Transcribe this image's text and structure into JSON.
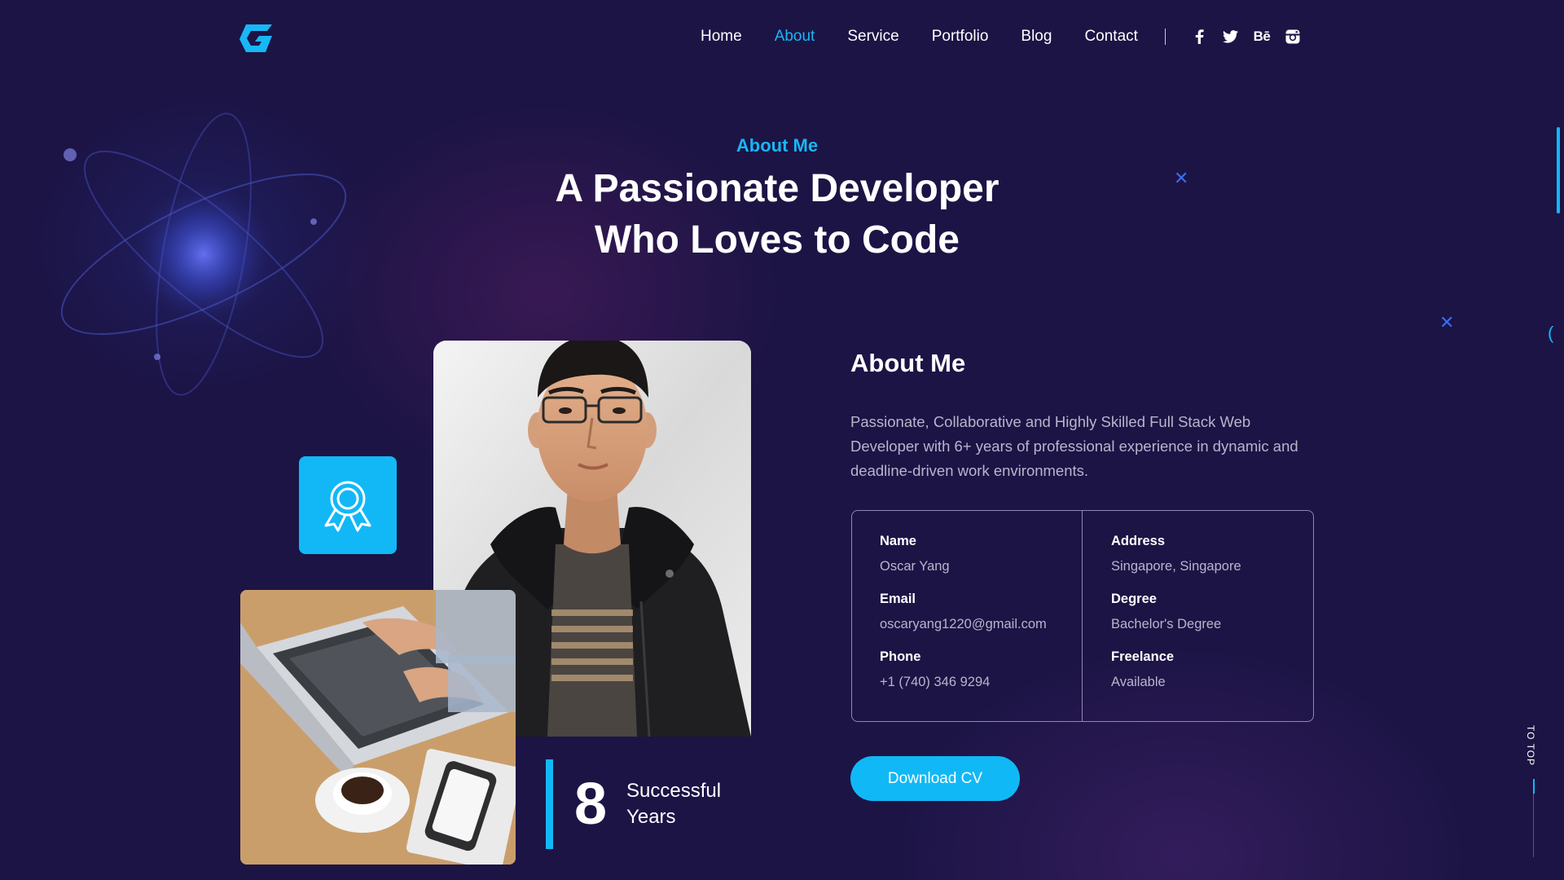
{
  "brand": {
    "logo_icon": "g-logo-icon",
    "accent_color": "#18b7f5",
    "background_color": "#1c1445"
  },
  "nav": {
    "items": [
      {
        "label": "Home",
        "active": false
      },
      {
        "label": "About",
        "active": true
      },
      {
        "label": "Service",
        "active": false
      },
      {
        "label": "Portfolio",
        "active": false
      },
      {
        "label": "Blog",
        "active": false
      },
      {
        "label": "Contact",
        "active": false
      }
    ],
    "social": [
      {
        "icon": "facebook-icon"
      },
      {
        "icon": "twitter-icon"
      },
      {
        "icon": "behance-icon",
        "label": "Bē"
      },
      {
        "icon": "instagram-icon"
      }
    ]
  },
  "section": {
    "kicker": "About Me",
    "title_line1": "A Passionate Developer",
    "title_line2": "Who Loves to Code"
  },
  "experience": {
    "number": "8",
    "label": "Successful Years"
  },
  "about": {
    "heading": "About Me",
    "paragraph": "Passionate, Collaborative and Highly Skilled Full Stack Web Developer with 6+ years of professional experience in dynamic and deadline-driven work environments.",
    "info_left": [
      {
        "label": "Name",
        "value": "Oscar Yang"
      },
      {
        "label": "Email",
        "value": "oscaryang1220@gmail.com"
      },
      {
        "label": "Phone",
        "value": "+1 (740) 346 9294"
      }
    ],
    "info_right": [
      {
        "label": "Address",
        "value": "Singapore, Singapore"
      },
      {
        "label": "Degree",
        "value": "Bachelor's Degree"
      },
      {
        "label": "Freelance",
        "value": "Available"
      }
    ],
    "cv_button": "Download CV"
  },
  "side": {
    "to_top": "TO TOP",
    "bracket": "("
  }
}
